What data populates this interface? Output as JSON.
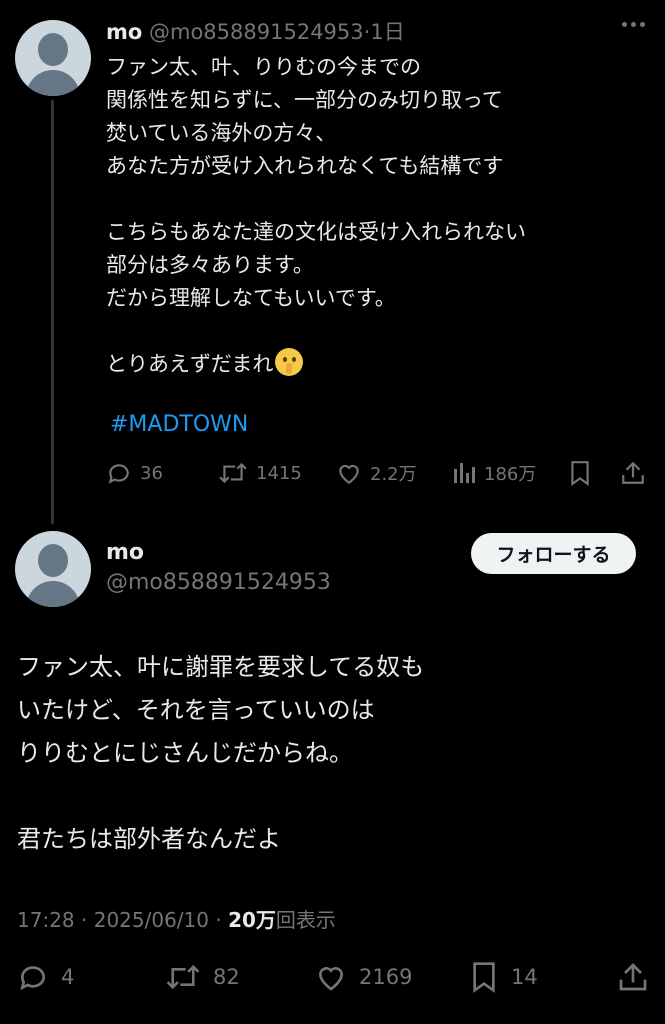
{
  "tweet1": {
    "name": "mo",
    "handle": "@mo858891524953",
    "separator": "·",
    "time": "1日",
    "lines": [
      "ファン太、叶、りりむの今までの",
      "関係性を知らずに、一部分のみ切り取って",
      "焚いている海外の方々、",
      "あなた方が受け入れられなくても結構です",
      "こちらもあなた達の文化は受け入れられない",
      "部分は多々あります。",
      "だから理解しなてもいいです。",
      "とりあえずだまれ"
    ],
    "emoji": "shushing-face",
    "hashtag": "#MADTOWN",
    "actions": {
      "replies": "36",
      "retweets": "1415",
      "likes": "2.2万",
      "views": "186万"
    }
  },
  "tweet2": {
    "name": "mo",
    "handle": "@mo858891524953",
    "follow_label": "フォローする",
    "lines": [
      "ファン太、叶に謝罪を要求してる奴も",
      "いたけど、それを言っていいのは",
      "りりむとにじさんじだからね。",
      "君たちは部外者なんだよ"
    ],
    "time": "17:28",
    "date": "2025/06/10",
    "views_count": "20万",
    "views_label": "回表示",
    "dot": "·",
    "actions": {
      "replies": "4",
      "retweets": "82",
      "likes": "2169",
      "bookmarks": "14"
    }
  },
  "colors": {
    "background": "#000000",
    "text": "#e7e9ea",
    "muted": "#71767b",
    "link": "#1d9bf0",
    "thread_line": "#333639"
  }
}
